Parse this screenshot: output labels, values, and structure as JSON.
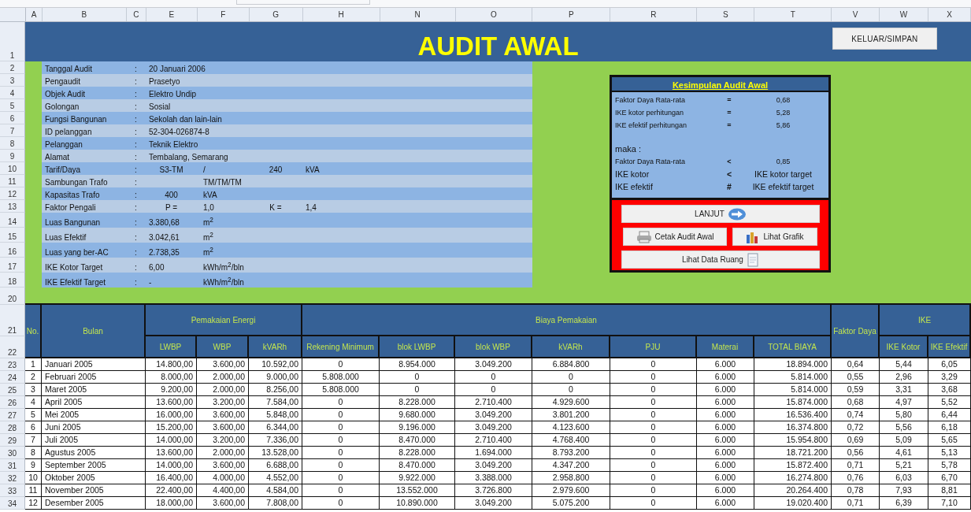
{
  "column_letters": [
    "A",
    "B",
    "C",
    "E",
    "F",
    "G",
    "H",
    "N",
    "O",
    "P",
    "R",
    "S",
    "T",
    "V",
    "W",
    "X"
  ],
  "title_row": {
    "row": "1",
    "title": "AUDIT AWAL",
    "exit_button": "KELUAR/SIMPAN"
  },
  "info": [
    {
      "row": "2",
      "kind": "text",
      "label": "Tanggal Audit",
      "sep": ":",
      "e": "20 Januari 2006"
    },
    {
      "row": "3",
      "kind": "text",
      "label": "Pengaudit",
      "sep": ":",
      "e": "Prasetyo"
    },
    {
      "row": "4",
      "kind": "text",
      "label": "Objek Audit",
      "sep": ":",
      "e": "Elektro Undip"
    },
    {
      "row": "5",
      "kind": "text",
      "label": "Golongan",
      "sep": ":",
      "e": "Sosial"
    },
    {
      "row": "6",
      "kind": "text",
      "label": "Fungsi Bangunan",
      "sep": ":",
      "e": "Sekolah dan lain-lain"
    },
    {
      "row": "7",
      "kind": "text",
      "label": "ID pelanggan",
      "sep": ":",
      "e": "52-304-026874-8"
    },
    {
      "row": "8",
      "kind": "text",
      "label": "Pelanggan",
      "sep": ":",
      "e": "Teknik Elektro"
    },
    {
      "row": "9",
      "kind": "text",
      "label": "Alamat",
      "sep": ":",
      "e": "Tembalang, Semarang"
    },
    {
      "row": "10",
      "kind": "split",
      "label": "Tarif/Daya",
      "sep": ":",
      "e": "S3-TM",
      "f": "/",
      "g": "240",
      "h": "kVA"
    },
    {
      "row": "11",
      "kind": "text",
      "label": "Sambungan Trafo",
      "sep": ":",
      "f": "TM/TM/TM"
    },
    {
      "row": "12",
      "kind": "split",
      "label": "Kapasitas Trafo",
      "sep": ":",
      "e": "400",
      "f": "kVA"
    },
    {
      "row": "13",
      "kind": "split",
      "label": "Faktor Pengali",
      "sep": ":",
      "e": "P =",
      "f": "1,0",
      "g": "K =",
      "h": "1,4"
    },
    {
      "row": "14",
      "kind": "text",
      "label": "Luas Bangunan",
      "sep": ":",
      "e": "3.380,68",
      "f": "m$^{2}$"
    },
    {
      "row": "15",
      "kind": "text",
      "label": "Luas Efektif",
      "sep": ":",
      "e": "3.042,61",
      "f": "m$^{2}$"
    },
    {
      "row": "16",
      "kind": "text",
      "label": "Luas yang ber-AC",
      "sep": ":",
      "e": "2.738,35",
      "f": "m$^{2}$"
    },
    {
      "row": "17",
      "kind": "text",
      "label": "IKE Kotor Target",
      "sep": ":",
      "e": "6,00",
      "f": "kWh/m$^{2}$/bln"
    },
    {
      "row": "18",
      "kind": "text",
      "label": "IKE Efektif Target",
      "sep": ":",
      "e": "-",
      "f": "kWh/m$^{2}$/bln"
    }
  ],
  "summary": {
    "title": "Kesimpulan Audit Awal",
    "results": [
      {
        "label": "Faktor Daya Rata-rata",
        "op": "=",
        "value": "0,68"
      },
      {
        "label": "IKE kotor perhitungan",
        "op": "=",
        "value": "5,28"
      },
      {
        "label": "IKE efektif perhitungan",
        "op": "=",
        "value": "5,86"
      }
    ],
    "then_label": "maka :",
    "conclusions": [
      {
        "label": "Faktor Daya Rata-rata",
        "op": "<",
        "value": "0,85"
      },
      {
        "label": "IKE kotor",
        "op": "<",
        "value": "IKE kotor target"
      },
      {
        "label": "IKE efektif",
        "op": "#",
        "value": "IKE efektif target"
      }
    ],
    "buttons": {
      "next": "LANJUT",
      "print": "Cetak Audit Awal",
      "chart": "Lihat Grafik",
      "rooms": "Lihat Data Ruang"
    }
  },
  "spacer_row": "20",
  "table": {
    "header_rows": [
      "21",
      "22"
    ],
    "column_groups": {
      "energy": "Pemakaian Energi",
      "cost": "Biaya Pemakaian",
      "ike": "IKE"
    },
    "columns": [
      "No.",
      "Bulan",
      "LWBP",
      "WBP",
      "kVARh",
      "Rekening Minimum",
      "blok LWBP",
      "blok WBP",
      "kVARh",
      "PJU",
      "Materai",
      "TOTAL BIAYA",
      "Faktor Daya",
      "IKE Kotor",
      "IKE Efektif"
    ],
    "rows": [
      {
        "row": "23",
        "cells": [
          "1",
          "Januari 2005",
          "14.800,00",
          "3.600,00",
          "10.592,00",
          "0",
          "8.954.000",
          "3.049.200",
          "6.884.800",
          "0",
          "6.000",
          "18.894.000",
          "0,64",
          "5,44",
          "6,05"
        ]
      },
      {
        "row": "24",
        "cells": [
          "2",
          "Februari 2005",
          "8.000,00",
          "2.000,00",
          "9.000,00",
          "5.808.000",
          "0",
          "0",
          "0",
          "0",
          "6.000",
          "5.814.000",
          "0,55",
          "2,96",
          "3,29"
        ]
      },
      {
        "row": "25",
        "cells": [
          "3",
          "Maret 2005",
          "9.200,00",
          "2.000,00",
          "8.256,00",
          "5.808.000",
          "0",
          "0",
          "0",
          "0",
          "6.000",
          "5.814.000",
          "0,59",
          "3,31",
          "3,68"
        ]
      },
      {
        "row": "26",
        "cells": [
          "4",
          "April 2005",
          "13.600,00",
          "3.200,00",
          "7.584,00",
          "0",
          "8.228.000",
          "2.710.400",
          "4.929.600",
          "0",
          "6.000",
          "15.874.000",
          "0,68",
          "4,97",
          "5,52"
        ]
      },
      {
        "row": "27",
        "cells": [
          "5",
          "Mei 2005",
          "16.000,00",
          "3.600,00",
          "5.848,00",
          "0",
          "9.680.000",
          "3.049.200",
          "3.801.200",
          "0",
          "6.000",
          "16.536.400",
          "0,74",
          "5,80",
          "6,44"
        ]
      },
      {
        "row": "28",
        "cells": [
          "6",
          "Juni 2005",
          "15.200,00",
          "3.600,00",
          "6.344,00",
          "0",
          "9.196.000",
          "3.049.200",
          "4.123.600",
          "0",
          "6.000",
          "16.374.800",
          "0,72",
          "5,56",
          "6,18"
        ]
      },
      {
        "row": "29",
        "cells": [
          "7",
          "Juli 2005",
          "14.000,00",
          "3.200,00",
          "7.336,00",
          "0",
          "8.470.000",
          "2.710.400",
          "4.768.400",
          "0",
          "6.000",
          "15.954.800",
          "0,69",
          "5,09",
          "5,65"
        ]
      },
      {
        "row": "30",
        "cells": [
          "8",
          "Agustus 2005",
          "13.600,00",
          "2.000,00",
          "13.528,00",
          "0",
          "8.228.000",
          "1.694.000",
          "8.793.200",
          "0",
          "6.000",
          "18.721.200",
          "0,56",
          "4,61",
          "5,13"
        ]
      },
      {
        "row": "31",
        "cells": [
          "9",
          "September 2005",
          "14.000,00",
          "3.600,00",
          "6.688,00",
          "0",
          "8.470.000",
          "3.049.200",
          "4.347.200",
          "0",
          "6.000",
          "15.872.400",
          "0,71",
          "5,21",
          "5,78"
        ]
      },
      {
        "row": "32",
        "cells": [
          "10",
          "Oktober 2005",
          "16.400,00",
          "4.000,00",
          "4.552,00",
          "0",
          "9.922.000",
          "3.388.000",
          "2.958.800",
          "0",
          "6.000",
          "16.274.800",
          "0,76",
          "6,03",
          "6,70"
        ]
      },
      {
        "row": "33",
        "cells": [
          "11",
          "November 2005",
          "22.400,00",
          "4.400,00",
          "4.584,00",
          "0",
          "13.552.000",
          "3.726.800",
          "2.979.600",
          "0",
          "6.000",
          "20.264.400",
          "0,78",
          "7,93",
          "8,81"
        ]
      },
      {
        "row": "34",
        "cells": [
          "12",
          "Desember 2005",
          "18.000,00",
          "3.600,00",
          "7.808,00",
          "0",
          "10.890.000",
          "3.049.200",
          "5.075.200",
          "0",
          "6.000",
          "19.020.400",
          "0,71",
          "6,39",
          "7,10"
        ]
      }
    ]
  }
}
